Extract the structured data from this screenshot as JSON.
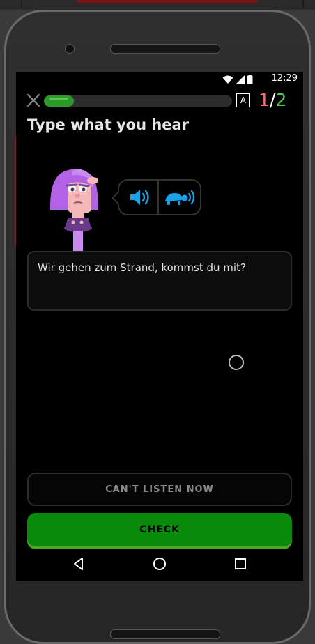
{
  "statusbar": {
    "time": "12:29"
  },
  "header": {
    "progress_percent": 16,
    "a_label": "A",
    "counter_current": "1",
    "counter_separator": "/",
    "counter_total": "2"
  },
  "prompt": {
    "title": "Type what you hear"
  },
  "answer": {
    "text": "Wir gehen zum Strand, kommst du mit?"
  },
  "buttons": {
    "cant_listen": "CAN'T LISTEN NOW",
    "check": "CHECK"
  },
  "colors": {
    "progress": "#2b9a2b",
    "counter_current": "#ff6b7a",
    "counter_total": "#58c758",
    "check_button": "#0a8a0a",
    "audio_icon": "#1aa3e8"
  },
  "icons": [
    "close-icon",
    "wifi-icon",
    "signal-icon",
    "battery-icon",
    "speaker-icon",
    "turtle-speaker-icon",
    "back-icon",
    "home-icon",
    "recents-icon"
  ]
}
